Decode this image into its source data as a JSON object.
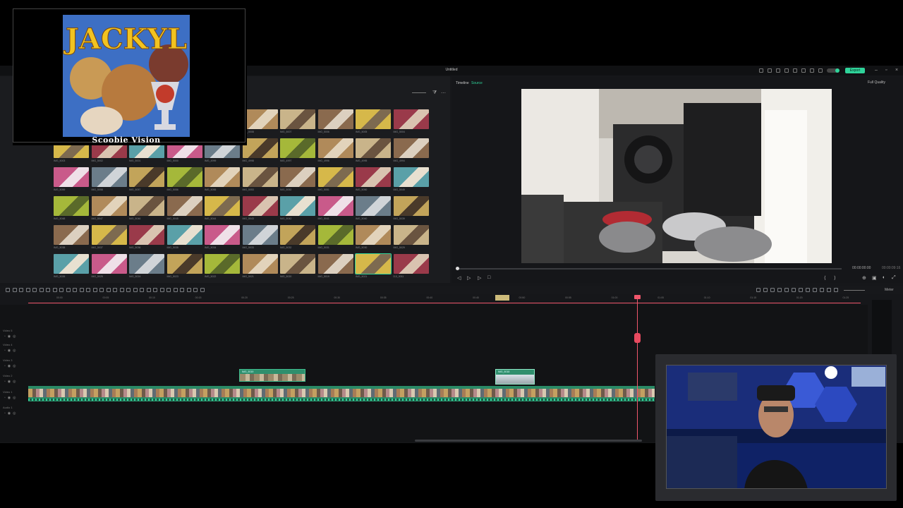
{
  "app": {
    "title": "Untitled",
    "export_label": "Export"
  },
  "player": {
    "tabs": [
      "Timeline",
      "Source"
    ],
    "quality": "Full Quality",
    "timecode_current": "00:00:00:00",
    "timecode_total": "00:00:09:16",
    "progress": 0.0
  },
  "media": {
    "rows": [
      [
        "IMG_5008",
        "IMG_5007",
        "IMG_5006",
        "IMG_5005",
        "IMG_5004"
      ],
      [
        "IMG_5003",
        "IMG_5002",
        "IMG_5001",
        "IMG_5000",
        "IMG_4999",
        "IMG_4998",
        "IMG_4997",
        "IMG_4996",
        "IMG_4995",
        "IMG_4994"
      ],
      [
        "IMG_5059",
        "IMG_5058",
        "IMG_5057",
        "IMG_5056",
        "IMG_5055",
        "IMG_5053",
        "IMG_5052",
        "IMG_5051",
        "IMG_5050",
        "IMG_5049"
      ],
      [
        "IMG_5048",
        "IMG_5047",
        "IMG_5046",
        "IMG_5045",
        "IMG_5044",
        "IMG_5043",
        "IMG_5042",
        "IMG_5041",
        "IMG_5040",
        "IMG_5039"
      ],
      [
        "IMG_5038",
        "IMG_5037",
        "IMG_5036",
        "IMG_5035",
        "IMG_5034",
        "IMG_5033",
        "IMG_5032",
        "IMG_5031",
        "IMG_5030",
        "IMG_5029"
      ],
      [
        "IMG_5026",
        "IMG_5025",
        "IMG_5024",
        "IMG_5023",
        "IMG_5022",
        "IMG_5021",
        "IMG_5020",
        "IMG_5019",
        "IMG_5021",
        "DJI_0011"
      ]
    ],
    "selected": "IMG_5021"
  },
  "timeline": {
    "ruler": [
      "00:00",
      "00:05",
      "00:10",
      "00:15",
      "00:20",
      "00:25",
      "00:30",
      "00:35",
      "00:40",
      "00:45",
      "00:50",
      "00:55",
      "01:00",
      "01:05",
      "01:10",
      "01:15",
      "01:20",
      "01:25"
    ],
    "tracks": [
      "Video 5",
      "Video 4",
      "Video 3",
      "Video 2",
      "Video 1",
      "Audio 1"
    ],
    "clip_a": "IMG_5019",
    "clip_b": "IMG_5018",
    "meter_label": "Meter"
  },
  "overlay": {
    "album_caption": "Scoobie Vision",
    "album_text": "JACKYL"
  },
  "colors": {
    "accent": "#2fd39a",
    "playhead": "#f0566b"
  }
}
